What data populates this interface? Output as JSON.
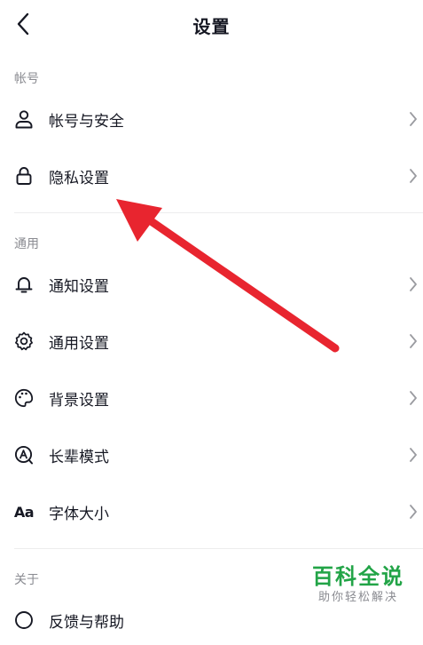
{
  "header": {
    "title": "设置",
    "back_icon": "chevron-left-icon"
  },
  "sections": {
    "account": {
      "label": "帐号",
      "items": [
        {
          "label": "帐号与安全",
          "icon": "person-icon"
        },
        {
          "label": "隐私设置",
          "icon": "lock-icon"
        }
      ]
    },
    "general": {
      "label": "通用",
      "items": [
        {
          "label": "通知设置",
          "icon": "bell-icon"
        },
        {
          "label": "通用设置",
          "icon": "gear-icon"
        },
        {
          "label": "背景设置",
          "icon": "palette-icon"
        },
        {
          "label": "长辈模式",
          "icon": "elder-mode-icon"
        },
        {
          "label": "字体大小",
          "icon": "font-size-icon",
          "icon_text": "Aa"
        }
      ]
    },
    "about": {
      "label": "关于",
      "items": [
        {
          "label": "反馈与帮助",
          "icon": "help-icon"
        }
      ]
    }
  },
  "annotation": {
    "arrow_color": "#e8252f"
  },
  "watermark": {
    "main": "百科全说",
    "sub": "助你轻松解决",
    "color": "#22a447"
  }
}
